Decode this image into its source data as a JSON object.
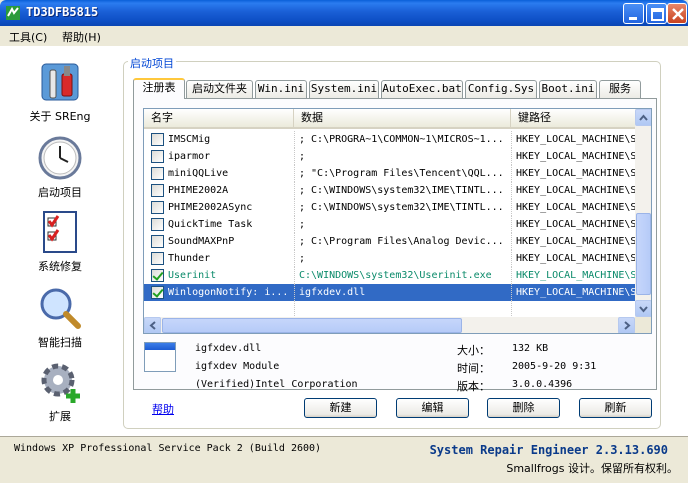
{
  "window": {
    "title": "TD3DFB5815",
    "minimize_icon": "minimize-icon",
    "maximize_icon": "maximize-icon",
    "close_icon": "close-icon"
  },
  "menu": {
    "tools": "工具(C)",
    "help": "帮助(H)"
  },
  "nav": [
    {
      "label": "关于 SREng",
      "icon": "tools-icon"
    },
    {
      "label": "启动项目",
      "icon": "clock-icon"
    },
    {
      "label": "系统修复",
      "icon": "checklist-icon"
    },
    {
      "label": "智能扫描",
      "icon": "magnifier-icon"
    },
    {
      "label": "扩展",
      "icon": "gear-plus-icon"
    }
  ],
  "group_title": "启动项目",
  "tabs": [
    "注册表",
    "启动文件夹",
    "Win.ini",
    "System.ini",
    "AutoExec.bat",
    "Config.Sys",
    "Boot.ini",
    "服务"
  ],
  "list": {
    "columns": [
      "名字",
      "数据",
      "键路径"
    ],
    "rows": [
      {
        "checked": false,
        "name": "IMSCMig",
        "data": "; C:\\PROGRA~1\\COMMON~1\\MICROS~1...",
        "key": "HKEY_LOCAL_MACHINE\\S",
        "style": "normal"
      },
      {
        "checked": false,
        "name": "iparmor",
        "data": ";",
        "key": "HKEY_LOCAL_MACHINE\\S",
        "style": "normal"
      },
      {
        "checked": false,
        "name": "miniQQLive",
        "data": "; \"C:\\Program Files\\Tencent\\QQL...",
        "key": "HKEY_LOCAL_MACHINE\\S",
        "style": "normal"
      },
      {
        "checked": false,
        "name": "PHIME2002A",
        "data": "; C:\\WINDOWS\\system32\\IME\\TINTL...",
        "key": "HKEY_LOCAL_MACHINE\\S",
        "style": "normal"
      },
      {
        "checked": false,
        "name": "PHIME2002ASync",
        "data": "; C:\\WINDOWS\\system32\\IME\\TINTL...",
        "key": "HKEY_LOCAL_MACHINE\\S",
        "style": "normal"
      },
      {
        "checked": false,
        "name": "QuickTime Task",
        "data": ";",
        "key": "HKEY_LOCAL_MACHINE\\S",
        "style": "normal"
      },
      {
        "checked": false,
        "name": "SoundMAXPnP",
        "data": "; C:\\Program Files\\Analog Devic...",
        "key": "HKEY_LOCAL_MACHINE\\S",
        "style": "normal"
      },
      {
        "checked": false,
        "name": "Thunder",
        "data": ";",
        "key": "HKEY_LOCAL_MACHINE\\S",
        "style": "normal"
      },
      {
        "checked": true,
        "name": "Userinit",
        "data": "C:\\WINDOWS\\system32\\Userinit.exe",
        "key": "HKEY_LOCAL_MACHINE\\S",
        "style": "green"
      },
      {
        "checked": true,
        "name": "WinlogonNotify: i...",
        "data": "igfxdev.dll",
        "key": "HKEY_LOCAL_MACHINE\\S",
        "style": "selected"
      },
      {
        "checked": false,
        "name": "",
        "data": "",
        "key": "",
        "style": "empty"
      }
    ]
  },
  "details": {
    "file": "igfxdev.dll",
    "description": "igfxdev Module",
    "company": "(Verified)Intel Corporation",
    "size_label": "大小：",
    "size": "132 KB",
    "time_label": "时间：",
    "time": "2005-9-20 9:31",
    "version_label": "版本：",
    "version": "3.0.0.4396"
  },
  "buttons": {
    "help": "帮助",
    "new": "新建",
    "edit": "编辑",
    "delete": "删除",
    "refresh": "刷新"
  },
  "status": {
    "os": "Windows XP Professional Service Pack 2 (Build 2600)",
    "brand": "System Repair Engineer 2.3.13.690",
    "credit": "Smallfrogs 设计。保留所有权利。"
  }
}
